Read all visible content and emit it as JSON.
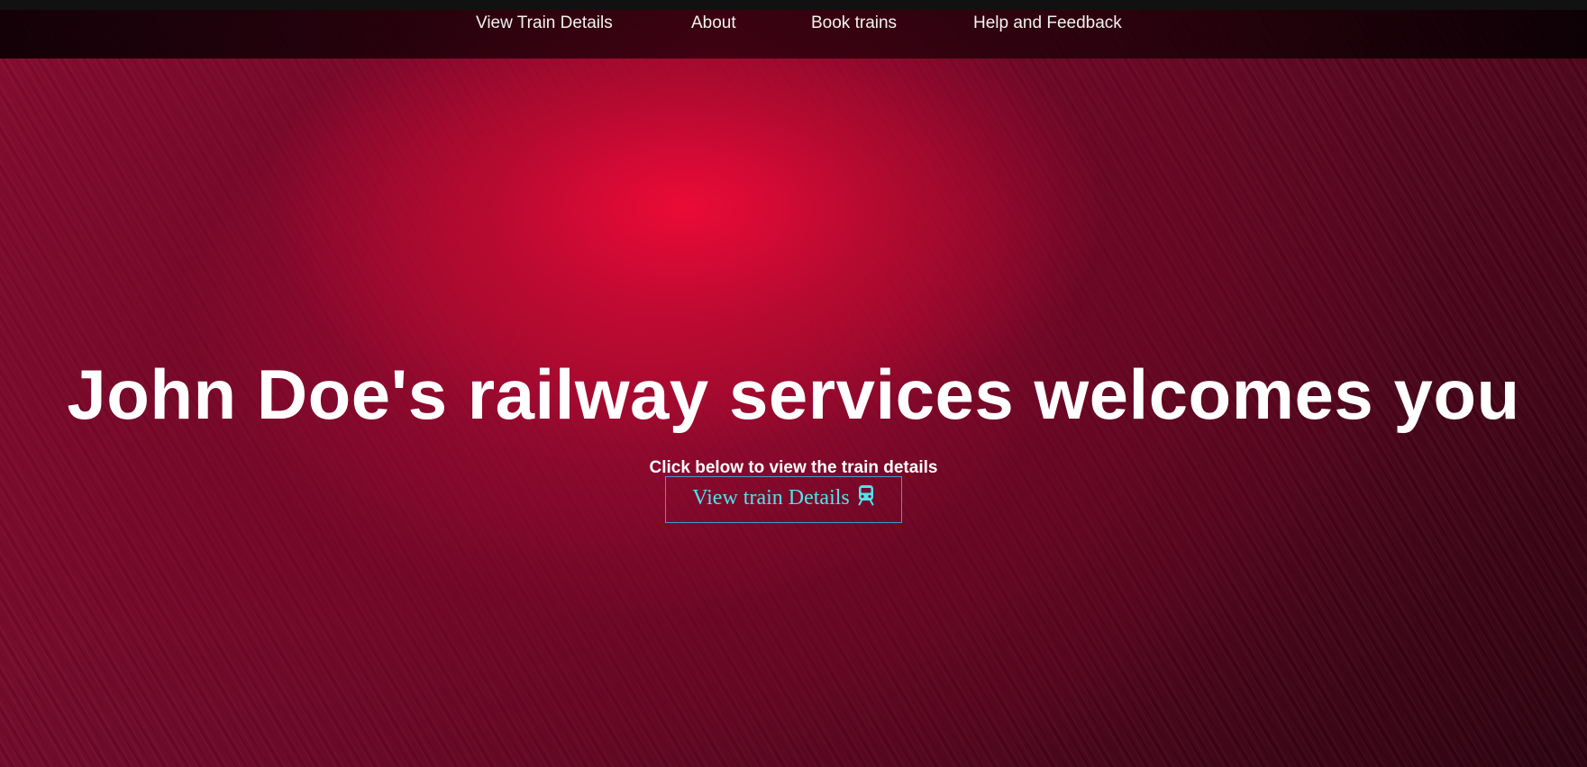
{
  "nav": {
    "items": [
      {
        "label": "View Train Details"
      },
      {
        "label": "About"
      },
      {
        "label": "Book trains"
      },
      {
        "label": "Help and Feedback"
      }
    ]
  },
  "hero": {
    "title": "John Doe's railway services welcomes you",
    "subtitle": "Click below to view the train details",
    "cta_label": "View train Details",
    "cta_icon": "train-icon"
  },
  "colors": {
    "background_primary": "#b00a35",
    "background_highlight": "#e8083a",
    "nav_background": "#14000a",
    "text": "#ffffff",
    "cta_text": "#4fe3ee",
    "cta_border": "#3aa0d8"
  }
}
